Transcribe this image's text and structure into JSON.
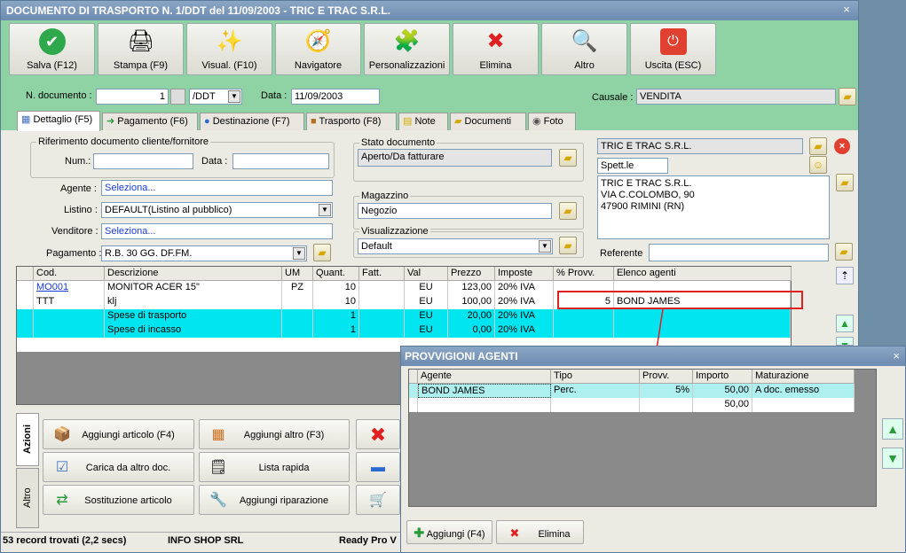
{
  "window": {
    "title": "DOCUMENTO DI TRASPORTO N. 1/DDT del 11/09/2003 - TRIC E TRAC S.R.L.",
    "close": "×"
  },
  "toolbar": [
    {
      "label": "Salva (F12)",
      "icon": "✔"
    },
    {
      "label": "Stampa (F9)",
      "icon": "🖨"
    },
    {
      "label": "Visual. (F10)",
      "icon": "✨"
    },
    {
      "label": "Navigatore",
      "icon": "🧭"
    },
    {
      "label": "Personalizzazioni",
      "icon": "🧩"
    },
    {
      "label": "Elimina",
      "icon": "✖"
    },
    {
      "label": "Altro",
      "icon": "🔍"
    },
    {
      "label": "Uscita (ESC)",
      "icon": "⏻"
    }
  ],
  "header": {
    "ndoc_label": "N. documento :",
    "ndoc_value": "1",
    "series_value": "/DDT",
    "date_label": "Data :",
    "date_value": "11/09/2003",
    "causale_label": "Causale :",
    "causale_value": "VENDITA"
  },
  "tabs": [
    "Dettaglio (F5)",
    "Pagamento (F6)",
    "Destinazione (F7)",
    "Trasporto (F8)",
    "Note",
    "Documenti",
    "Foto"
  ],
  "rif": {
    "title": "Riferimento documento cliente/fornitore",
    "num_label": "Num.:",
    "data_label": "Data :"
  },
  "form": {
    "agente_label": "Agente :",
    "agente_value": "Seleziona...",
    "listino_label": "Listino :",
    "listino_value": "DEFAULT(Listino al pubblico)",
    "venditore_label": "Venditore :",
    "venditore_value": "Seleziona...",
    "pagamento_label": "Pagamento :",
    "pagamento_value": "R.B. 30 GG. DF.FM."
  },
  "stato": {
    "title": "Stato documento",
    "value": "Aperto/Da fatturare"
  },
  "magazzino": {
    "title": "Magazzino",
    "value": "Negozio"
  },
  "visualizzazione": {
    "title": "Visualizzazione",
    "value": "Default"
  },
  "cliente": {
    "name": "TRIC E TRAC S.R.L.",
    "salutation": "Spett.le",
    "address": [
      "TRIC E TRAC S.R.L.",
      "VIA C.COLOMBO, 90",
      "47900 RIMINI (RN)"
    ],
    "referente_label": "Referente"
  },
  "grid": {
    "headers": [
      "Cod.",
      "Descrizione",
      "UM",
      "Quant.",
      "Fatt.",
      "Val",
      "Prezzo",
      "Imposte",
      "% Provv.",
      "Elenco agenti"
    ],
    "rows": [
      {
        "cod": "MO001",
        "desc": "MONITOR ACER 15\"",
        "um": "PZ",
        "qty": "10",
        "fatt": "",
        "val": "EU",
        "prezzo": "123,00",
        "imposte": "20% IVA",
        "provv": "",
        "agenti": ""
      },
      {
        "cod": "TTT",
        "desc": "klj",
        "um": "",
        "qty": "10",
        "fatt": "",
        "val": "EU",
        "prezzo": "100,00",
        "imposte": "20% IVA",
        "provv": "5",
        "agenti": "BOND JAMES"
      },
      {
        "cod": "",
        "desc": "Spese di trasporto",
        "um": "",
        "qty": "1",
        "fatt": "",
        "val": "EU",
        "prezzo": "20,00",
        "imposte": "20% IVA",
        "provv": "",
        "agenti": ""
      },
      {
        "cod": "",
        "desc": "Spese di incasso",
        "um": "",
        "qty": "1",
        "fatt": "",
        "val": "EU",
        "prezzo": "0,00",
        "imposte": "20% IVA",
        "provv": "",
        "agenti": ""
      }
    ]
  },
  "side_tabs": [
    "Azioni",
    "Altro"
  ],
  "actions": [
    {
      "label": "Aggiungi articolo (F4)",
      "icon": "📦"
    },
    {
      "label": "Aggiungi altro (F3)",
      "icon": "▦"
    },
    {
      "label": "Carica da altro doc.",
      "icon": "☑"
    },
    {
      "label": "Lista rapida",
      "icon": "🗒"
    },
    {
      "label": "Sostituzione articolo",
      "icon": "⇄"
    },
    {
      "label": "Aggiungi riparazione",
      "icon": "🔧"
    }
  ],
  "status": {
    "records": "53 record trovati (2,2 secs)",
    "company": "INFO SHOP SRL",
    "ready": "Ready Pro V"
  },
  "dialog": {
    "title": "PROVVIGIONI AGENTI",
    "close": "×",
    "headers": [
      "Agente",
      "Tipo",
      "Provv.",
      "Importo",
      "Maturazione"
    ],
    "rows": [
      {
        "agente": "BOND JAMES",
        "tipo": "Perc.",
        "provv": "5%",
        "importo": "50,00",
        "maturazione": "A doc. emesso"
      },
      {
        "agente": "",
        "tipo": "",
        "provv": "",
        "importo": "50,00",
        "maturazione": ""
      }
    ],
    "add_label": "Aggiungi (F4)",
    "delete_label": "Elimina"
  },
  "colors": {
    "toolbar_bg": "#8fd3a5",
    "highlight_row": "#00e5f0",
    "callout": "#e02020",
    "title_bar": "#7a98bc"
  }
}
